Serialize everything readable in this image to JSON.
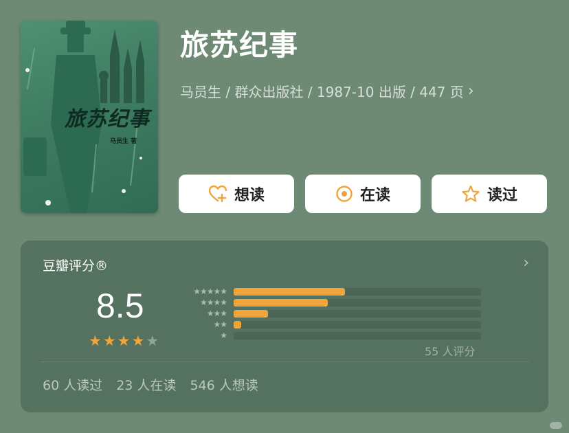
{
  "book": {
    "title": "旅苏纪事",
    "meta": "马员生 / 群众出版社 / 1987-10 出版 / 447 页",
    "cover": {
      "title": "旅苏纪事",
      "author": "马员生 著",
      "icon": "book-cover-illustration"
    }
  },
  "actions": [
    {
      "label": "想读",
      "icon": "heart-plus-icon"
    },
    {
      "label": "在读",
      "icon": "reading-circle-icon"
    },
    {
      "label": "读过",
      "icon": "star-outline-icon"
    }
  ],
  "rating": {
    "title": "豆瓣评分®",
    "score": "8.5",
    "stars": 4,
    "max_stars": 5,
    "distribution": [
      {
        "stars": "★★★★★",
        "fraction": 0.45
      },
      {
        "stars": "★★★★",
        "fraction": 0.38
      },
      {
        "stars": "★★★",
        "fraction": 0.14
      },
      {
        "stars": "★★",
        "fraction": 0.03
      },
      {
        "stars": "★",
        "fraction": 0.0
      }
    ],
    "count": "55 人评分"
  },
  "stats": {
    "read": "60 人读过",
    "reading": "23 人在读",
    "want": "546 人想读"
  },
  "colors": {
    "background": "#6e8a74",
    "card": "#557160",
    "accent": "#f0a43a"
  }
}
